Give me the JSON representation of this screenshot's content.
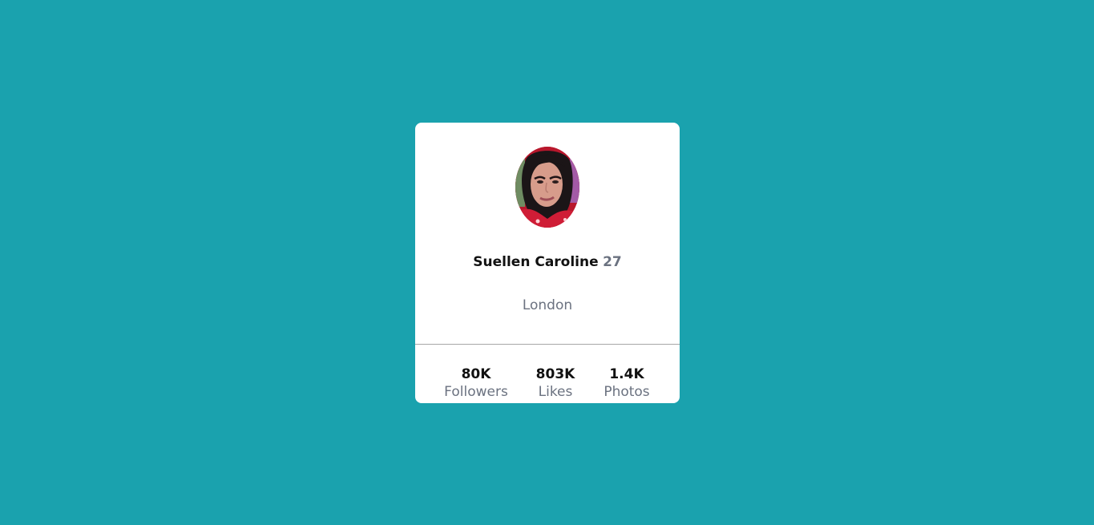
{
  "profile": {
    "name": "Suellen Caroline",
    "age": "27",
    "location": "London"
  },
  "stats": {
    "followers": {
      "value": "80K",
      "label": "Followers"
    },
    "likes": {
      "value": "803K",
      "label": "Likes"
    },
    "photos": {
      "value": "1.4K",
      "label": "Photos"
    }
  },
  "colors": {
    "background": "#1aa2ae",
    "card": "#ffffff",
    "primary_text": "#111111",
    "secondary_text": "#6b7280"
  }
}
